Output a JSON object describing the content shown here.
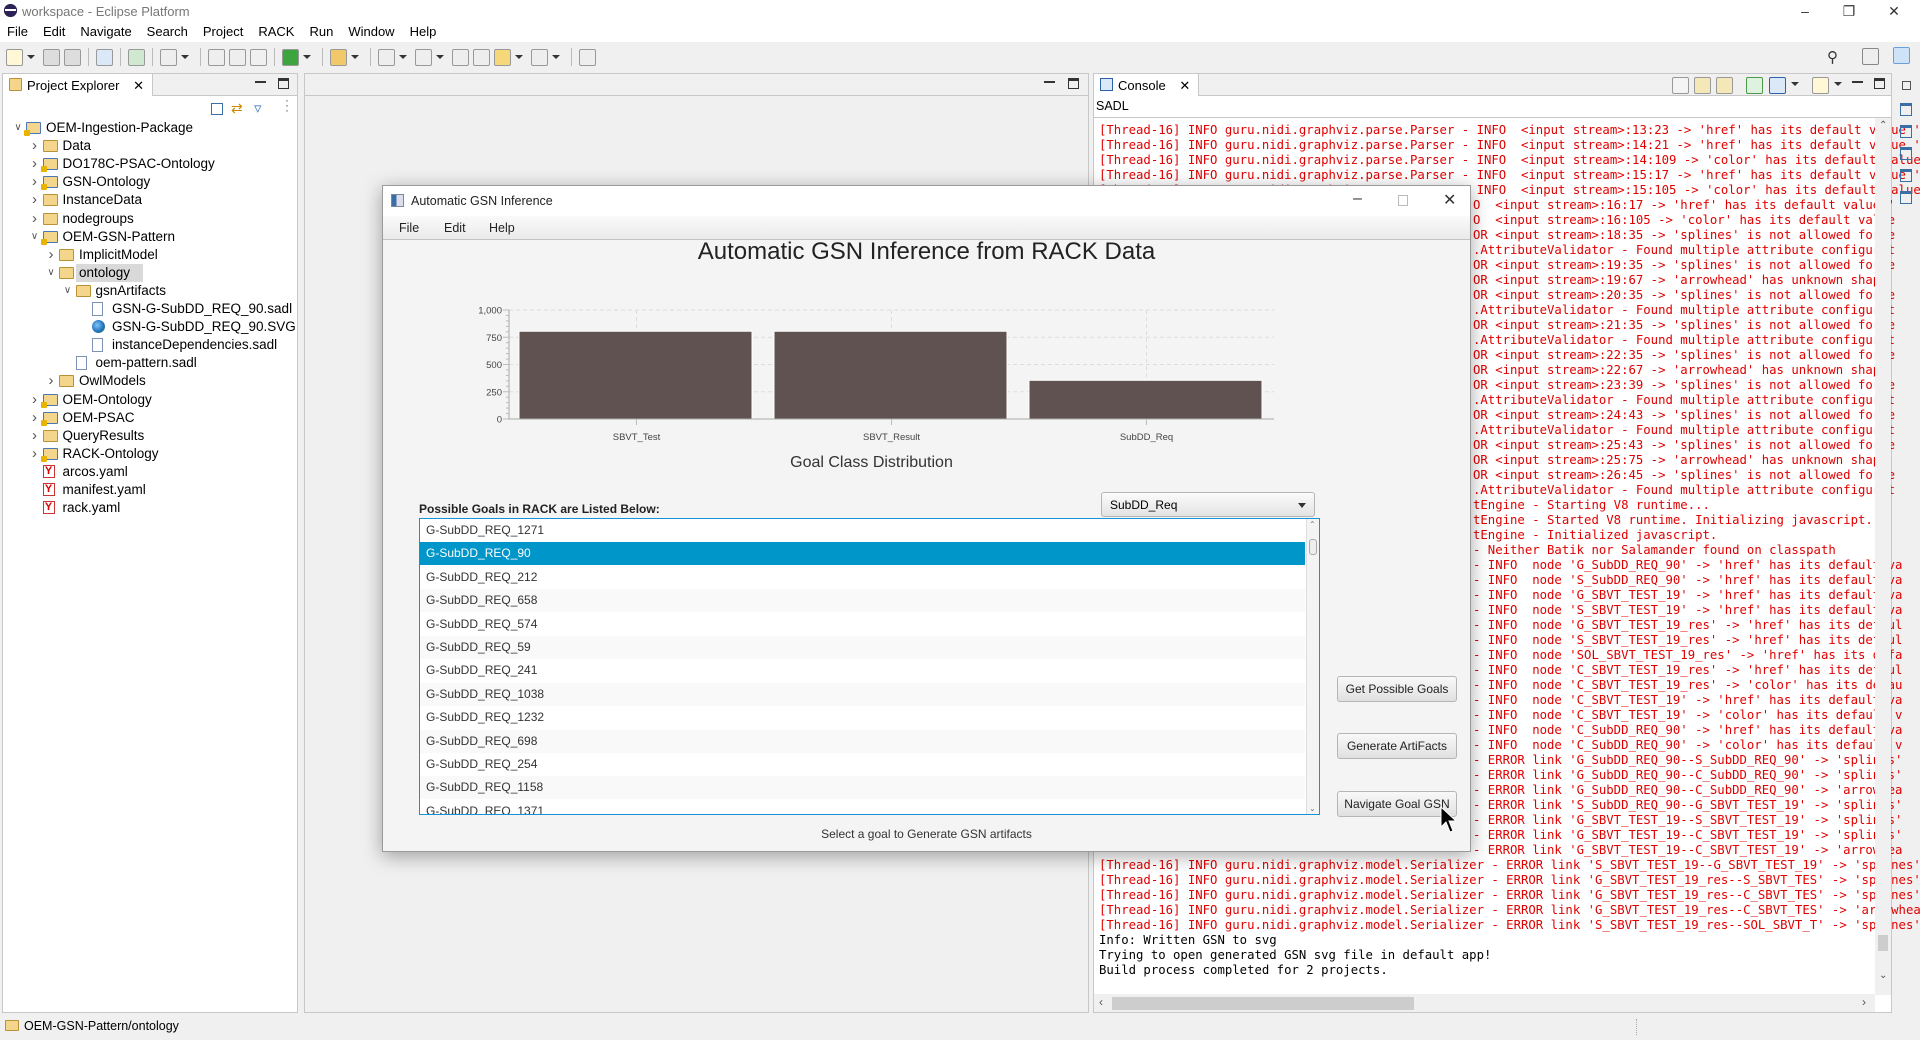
{
  "window": {
    "title": "workspace - Eclipse Platform",
    "controls": [
      "minimize",
      "restore",
      "close"
    ]
  },
  "menu": [
    "File",
    "Edit",
    "Navigate",
    "Search",
    "Project",
    "RACK",
    "Run",
    "Window",
    "Help"
  ],
  "toolbar_icons": [
    "new-icon",
    "save-icon",
    "save-all-icon",
    "binary-icon",
    "refresh-icon",
    "gear-icon",
    "toggle-icon",
    "block-icon",
    "pilcrow-icon",
    "run-icon",
    "marker-icon",
    "next-annotation-icon",
    "prev-annotation-icon",
    "last-edit-icon",
    "forward-edit-icon",
    "back-icon",
    "forward-icon",
    "pin-icon"
  ],
  "project_explorer": {
    "tab_label": "Project Explorer",
    "tree": [
      {
        "label": "OEM-Ingestion-Package",
        "level": 0,
        "twisty": "open",
        "icon": "project"
      },
      {
        "label": "Data",
        "level": 1,
        "twisty": "closed",
        "icon": "folder"
      },
      {
        "label": "DO178C-PSAC-Ontology",
        "level": 1,
        "twisty": "closed",
        "icon": "project"
      },
      {
        "label": "GSN-Ontology",
        "level": 1,
        "twisty": "closed",
        "icon": "project"
      },
      {
        "label": "InstanceData",
        "level": 1,
        "twisty": "closed",
        "icon": "folder"
      },
      {
        "label": "nodegroups",
        "level": 1,
        "twisty": "closed",
        "icon": "folder"
      },
      {
        "label": "OEM-GSN-Pattern",
        "level": 1,
        "twisty": "open",
        "icon": "project"
      },
      {
        "label": "ImplicitModel",
        "level": 2,
        "twisty": "closed",
        "icon": "folder"
      },
      {
        "label": "ontology",
        "level": 2,
        "twisty": "open",
        "icon": "folder",
        "selected": true
      },
      {
        "label": "gsnArtifacts",
        "level": 3,
        "twisty": "open",
        "icon": "folder"
      },
      {
        "label": "GSN-G-SubDD_REQ_90.sadl",
        "level": 4,
        "twisty": "none",
        "icon": "file"
      },
      {
        "label": "GSN-G-SubDD_REQ_90.SVG",
        "level": 4,
        "twisty": "none",
        "icon": "globe"
      },
      {
        "label": "instanceDependencies.sadl",
        "level": 4,
        "twisty": "none",
        "icon": "file"
      },
      {
        "label": "oem-pattern.sadl",
        "level": 3,
        "twisty": "none",
        "icon": "file"
      },
      {
        "label": "OwlModels",
        "level": 2,
        "twisty": "closed",
        "icon": "folder"
      },
      {
        "label": "OEM-Ontology",
        "level": 1,
        "twisty": "closed",
        "icon": "project"
      },
      {
        "label": "OEM-PSAC",
        "level": 1,
        "twisty": "closed",
        "icon": "project"
      },
      {
        "label": "QueryResults",
        "level": 1,
        "twisty": "closed",
        "icon": "folder"
      },
      {
        "label": "RACK-Ontology",
        "level": 1,
        "twisty": "closed",
        "icon": "project"
      },
      {
        "label": "arcos.yaml",
        "level": 1,
        "twisty": "none",
        "icon": "yaml"
      },
      {
        "label": "manifest.yaml",
        "level": 1,
        "twisty": "none",
        "icon": "yaml"
      },
      {
        "label": "rack.yaml",
        "level": 1,
        "twisty": "none",
        "icon": "yaml"
      }
    ]
  },
  "console": {
    "tab_label": "Console",
    "subtitle": "SADL",
    "colors": {
      "error": "#e00000",
      "normal": "#000000"
    },
    "lines": [
      {
        "t": "[Thread-16] INFO guru.nidi.graphviz.parse.Parser - INFO  <input stream>:13:23 -> 'href' has its default value '",
        "c": "red"
      },
      {
        "t": "[Thread-16] INFO guru.nidi.graphviz.parse.Parser - INFO  <input stream>:14:21 -> 'href' has its default value '",
        "c": "red"
      },
      {
        "t": "[Thread-16] INFO guru.nidi.graphviz.parse.Parser - INFO  <input stream>:14:109 -> 'color' has its default value",
        "c": "red"
      },
      {
        "t": "[Thread-16] INFO guru.nidi.graphviz.parse.Parser - INFO  <input stream>:15:17 -> 'href' has its default value '",
        "c": "red"
      },
      {
        "t": "[Thread-16] INFO guru.nidi.graphviz.parse.Parser - INFO  <input stream>:15:105 -> 'color' has its default value",
        "c": "red"
      },
      {
        "t": "O  <input stream>:16:17 -> 'href' has its default value '",
        "c": "red",
        "partial": true
      },
      {
        "t": "O  <input stream>:16:105 -> 'color' has its default value",
        "c": "red",
        "partial": true
      },
      {
        "t": "OR <input stream>:18:35 -> 'splines' is not allowed for e",
        "c": "red",
        "partial": true
      },
      {
        "t": ".AttributeValidator - Found multiple attribute configurat",
        "c": "red",
        "partial": true
      },
      {
        "t": "OR <input stream>:19:35 -> 'splines' is not allowed for e",
        "c": "red",
        "partial": true
      },
      {
        "t": "OR <input stream>:19:67 -> 'arrowhead' has unknown shape",
        "c": "red",
        "partial": true
      },
      {
        "t": "OR <input stream>:20:35 -> 'splines' is not allowed for e",
        "c": "red",
        "partial": true
      },
      {
        "t": ".AttributeValidator - Found multiple attribute configurat",
        "c": "red",
        "partial": true
      },
      {
        "t": "OR <input stream>:21:35 -> 'splines' is not allowed for e",
        "c": "red",
        "partial": true
      },
      {
        "t": ".AttributeValidator - Found multiple attribute configurat",
        "c": "red",
        "partial": true
      },
      {
        "t": "OR <input stream>:22:35 -> 'splines' is not allowed for e",
        "c": "red",
        "partial": true
      },
      {
        "t": "OR <input stream>:22:67 -> 'arrowhead' has unknown shape",
        "c": "red",
        "partial": true
      },
      {
        "t": "OR <input stream>:23:39 -> 'splines' is not allowed for e",
        "c": "red",
        "partial": true
      },
      {
        "t": ".AttributeValidator - Found multiple attribute configurat",
        "c": "red",
        "partial": true
      },
      {
        "t": "OR <input stream>:24:43 -> 'splines' is not allowed for e",
        "c": "red",
        "partial": true
      },
      {
        "t": ".AttributeValidator - Found multiple attribute configurat",
        "c": "red",
        "partial": true
      },
      {
        "t": "OR <input stream>:25:43 -> 'splines' is not allowed for e",
        "c": "red",
        "partial": true
      },
      {
        "t": "OR <input stream>:25:75 -> 'arrowhead' has unknown shape",
        "c": "red",
        "partial": true
      },
      {
        "t": "OR <input stream>:26:45 -> 'splines' is not allowed for e",
        "c": "red",
        "partial": true
      },
      {
        "t": ".AttributeValidator - Found multiple attribute configurat",
        "c": "red",
        "partial": true
      },
      {
        "t": "tEngine - Starting V8 runtime...",
        "c": "red",
        "partial": true
      },
      {
        "t": "tEngine - Started V8 runtime. Initializing javascript...",
        "c": "red",
        "partial": true
      },
      {
        "t": "tEngine - Initialized javascript.",
        "c": "red",
        "partial": true
      },
      {
        "t": "- Neither Batik nor Salamander found on classpath",
        "c": "red",
        "partial": true
      },
      {
        "t": "- INFO  node 'G_SubDD_REQ_90' -> 'href' has its default va",
        "c": "red",
        "partial": true
      },
      {
        "t": "- INFO  node 'S_SubDD_REQ_90' -> 'href' has its default va",
        "c": "red",
        "partial": true
      },
      {
        "t": "- INFO  node 'G_SBVT_TEST_19' -> 'href' has its default va",
        "c": "red",
        "partial": true
      },
      {
        "t": "- INFO  node 'S_SBVT_TEST_19' -> 'href' has its default va",
        "c": "red",
        "partial": true
      },
      {
        "t": "- INFO  node 'G_SBVT_TEST_19_res' -> 'href' has its defaul",
        "c": "red",
        "partial": true
      },
      {
        "t": "- INFO  node 'S_SBVT_TEST_19_res' -> 'href' has its defaul",
        "c": "red",
        "partial": true
      },
      {
        "t": "- INFO  node 'SOL_SBVT_TEST_19_res' -> 'href' has its defa",
        "c": "red",
        "partial": true
      },
      {
        "t": "- INFO  node 'C_SBVT_TEST_19_res' -> 'href' has its defaul",
        "c": "red",
        "partial": true
      },
      {
        "t": "- INFO  node 'C_SBVT_TEST_19_res' -> 'color' has its defau",
        "c": "red",
        "partial": true
      },
      {
        "t": "- INFO  node 'C_SBVT_TEST_19' -> 'href' has its default va",
        "c": "red",
        "partial": true
      },
      {
        "t": "- INFO  node 'C_SBVT_TEST_19' -> 'color' has its default v",
        "c": "red",
        "partial": true
      },
      {
        "t": "- INFO  node 'C_SubDD_REQ_90' -> 'href' has its default va",
        "c": "red",
        "partial": true
      },
      {
        "t": "- INFO  node 'C_SubDD_REQ_90' -> 'color' has its default v",
        "c": "red",
        "partial": true
      },
      {
        "t": "- ERROR link 'G_SubDD_REQ_90--S_SubDD_REQ_90' -> 'splines'",
        "c": "red",
        "partial": true
      },
      {
        "t": "- ERROR link 'G_SubDD_REQ_90--C_SubDD_REQ_90' -> 'splines'",
        "c": "red",
        "partial": true
      },
      {
        "t": "- ERROR link 'G_SubDD_REQ_90--C_SubDD_REQ_90' -> 'arrowhea",
        "c": "red",
        "partial": true
      },
      {
        "t": "- ERROR link 'S_SubDD_REQ_90--G_SBVT_TEST_19' -> 'splines'",
        "c": "red",
        "partial": true
      },
      {
        "t": "- ERROR link 'G_SBVT_TEST_19--S_SBVT_TEST_19' -> 'splines'",
        "c": "red",
        "partial": true
      },
      {
        "t": "- ERROR link 'G_SBVT_TEST_19--C_SBVT_TEST_19' -> 'splines'",
        "c": "red",
        "partial": true
      },
      {
        "t": "- ERROR link 'G_SBVT_TEST_19--C_SBVT_TEST_19' -> 'arrowhea",
        "c": "red",
        "partial": true
      },
      {
        "t": "[Thread-16] INFO guru.nidi.graphviz.model.Serializer - ERROR link 'S_SBVT_TEST_19--G_SBVT_TEST_19' -> 'splines'",
        "c": "red"
      },
      {
        "t": "[Thread-16] INFO guru.nidi.graphviz.model.Serializer - ERROR link 'G_SBVT_TEST_19_res--S_SBVT_TES' -> 'splines'",
        "c": "red"
      },
      {
        "t": "[Thread-16] INFO guru.nidi.graphviz.model.Serializer - ERROR link 'G_SBVT_TEST_19_res--C_SBVT_TES' -> 'splines'",
        "c": "red"
      },
      {
        "t": "[Thread-16] INFO guru.nidi.graphviz.model.Serializer - ERROR link 'G_SBVT_TEST_19_res--C_SBVT_TES' -> 'arrowhea",
        "c": "red"
      },
      {
        "t": "[Thread-16] INFO guru.nidi.graphviz.model.Serializer - ERROR link 'S_SBVT_TEST_19_res--SOL_SBVT_T' -> 'splines'",
        "c": "red"
      },
      {
        "t": "Info: Written GSN to svg",
        "c": "black"
      },
      {
        "t": "Trying to open generated GSN svg file in default app!",
        "c": "black"
      },
      {
        "t": "Build process completed for 2 projects.",
        "c": "black"
      }
    ]
  },
  "dialog": {
    "title": "Automatic GSN Inference",
    "menu": [
      "File",
      "Edit",
      "Help"
    ],
    "goals_label": "Possible Goals in RACK are Listed Below:",
    "combo_value": "SubDD_Req",
    "goals": [
      "G-SubDD_REQ_1271",
      "G-SubDD_REQ_90",
      "G-SubDD_REQ_212",
      "G-SubDD_REQ_658",
      "G-SubDD_REQ_574",
      "G-SubDD_REQ_59",
      "G-SubDD_REQ_241",
      "G-SubDD_REQ_1038",
      "G-SubDD_REQ_1232",
      "G-SubDD_REQ_698",
      "G-SubDD_REQ_254",
      "G-SubDD_REQ_1158",
      "G-SubDD_REQ_1371"
    ],
    "selected_goal": "G-SubDD_REQ_90",
    "selection_color": "#0096c9",
    "buttons": {
      "get_goals": "Get Possible Goals",
      "generate": "Generate ArtiFacts",
      "navigate": "Navigate Goal GSN"
    },
    "status": "Select a goal to Generate GSN artifacts"
  },
  "chart_data": {
    "type": "bar",
    "title": "Automatic GSN Inference from RACK Data",
    "xlabel": "Goal Class Distribution",
    "ylabel": "",
    "categories": [
      "SBVT_Test",
      "SBVT_Result",
      "SubDD_Req"
    ],
    "values": [
      805,
      805,
      355
    ],
    "ylim": [
      0,
      1000
    ],
    "yticks": [
      "0",
      "250",
      "500",
      "750",
      "1,000"
    ],
    "grid": true,
    "bar_color": "#5f5250"
  },
  "statusbar": {
    "path": "OEM-GSN-Pattern/ontology"
  }
}
